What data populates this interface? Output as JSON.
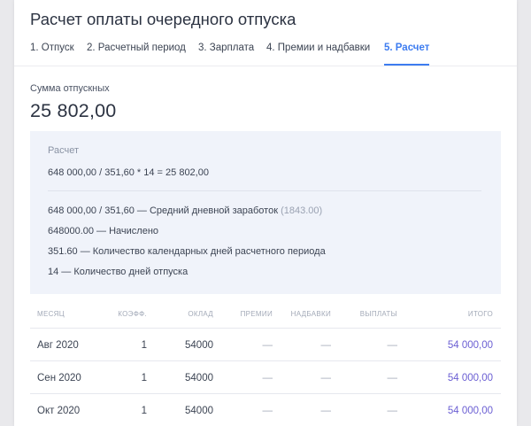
{
  "page": {
    "title": "Расчет оплаты очередного отпуска"
  },
  "tabs": [
    {
      "label": "1. Отпуск"
    },
    {
      "label": "2. Расчетный период"
    },
    {
      "label": "3. Зарплата"
    },
    {
      "label": "4. Премии и надбавки"
    },
    {
      "label": "5. Расчет",
      "active": true
    }
  ],
  "summary": {
    "label": "Сумма отпускных",
    "value": "25 802,00"
  },
  "calculation": {
    "title": "Расчет",
    "formula": "648 000,00 / 351,60 * 14 = 25 802,00",
    "lines": [
      {
        "text": "648 000,00 / 351,60 — Средний дневной заработок",
        "note": "(1843.00)"
      },
      {
        "text": "648000.00 — Начислено"
      },
      {
        "text": "351.60 — Количество календарных дней расчетного периода"
      },
      {
        "text": "14 — Количество дней отпуска"
      }
    ]
  },
  "table": {
    "headers": {
      "month": "МЕСЯЦ",
      "coef": "КОЭФФ.",
      "salary": "ОКЛАД",
      "bonus": "ПРЕМИИ",
      "allowance": "НАДБАВКИ",
      "payouts": "ВЫПЛАТЫ",
      "total": "ИТОГО"
    },
    "rows": [
      {
        "month": "Авг 2020",
        "coef": "1",
        "salary": "54000",
        "bonus": "—",
        "allowance": "—",
        "payouts": "—",
        "total": "54 000,00"
      },
      {
        "month": "Сен 2020",
        "coef": "1",
        "salary": "54000",
        "bonus": "—",
        "allowance": "—",
        "payouts": "—",
        "total": "54 000,00"
      },
      {
        "month": "Окт 2020",
        "coef": "1",
        "salary": "54000",
        "bonus": "—",
        "allowance": "—",
        "payouts": "—",
        "total": "54 000,00"
      }
    ]
  },
  "colors": {
    "accent": "#3d7cf0",
    "total": "#6b5fd3",
    "calc_bg": "#f0f3fa"
  }
}
